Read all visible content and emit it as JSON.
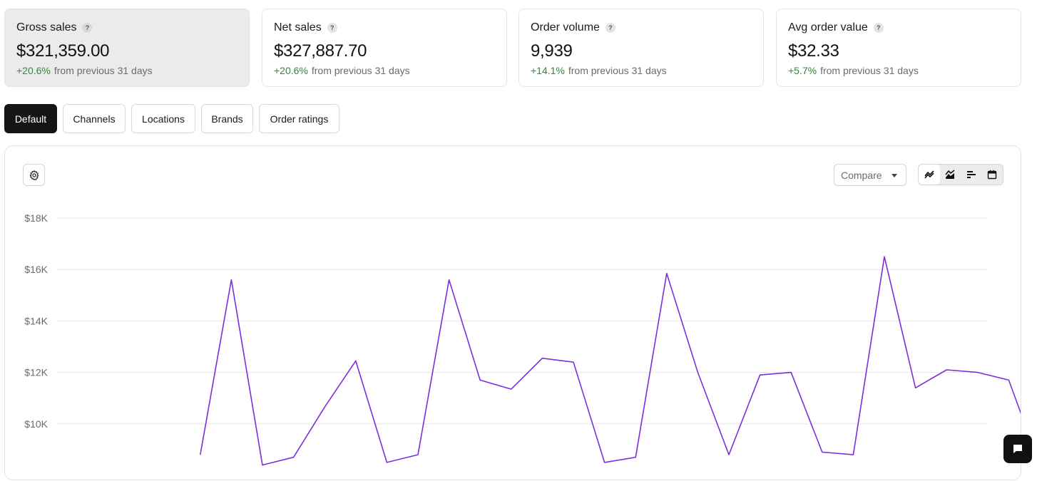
{
  "metrics": [
    {
      "title": "Gross sales",
      "value": "$321,359.00",
      "change": "+20.6%",
      "period": "from previous 31 days",
      "active": true
    },
    {
      "title": "Net sales",
      "value": "$327,887.70",
      "change": "+20.6%",
      "period": "from previous 31 days",
      "active": false
    },
    {
      "title": "Order volume",
      "value": "9,939",
      "change": "+14.1%",
      "period": "from previous 31 days",
      "active": false
    },
    {
      "title": "Avg order value",
      "value": "$32.33",
      "change": "+5.7%",
      "period": "from previous 31 days",
      "active": false
    }
  ],
  "help_glyph": "?",
  "tabs": [
    "Default",
    "Channels",
    "Locations",
    "Brands",
    "Order ratings"
  ],
  "active_tab": "Default",
  "toolbar": {
    "compare_label": "Compare",
    "view_icons": [
      "line-chart-icon",
      "area-chart-icon",
      "bar-chart-icon",
      "calendar-icon"
    ],
    "active_view": "line-chart-icon"
  },
  "colors": {
    "series": "#7b2fdc",
    "positive": "#2f8a3c",
    "active_tab": "#151515",
    "active_card": "#ebebeb"
  },
  "chart_data": {
    "type": "line",
    "title": "",
    "xlabel": "",
    "ylabel": "",
    "yticks": [
      "$10K",
      "$12K",
      "$14K",
      "$16K",
      "$18K"
    ],
    "ytick_values": [
      10000,
      12000,
      14000,
      16000,
      18000
    ],
    "grid": true,
    "x_range": [
      0,
      29
    ],
    "x_visible_from": 3,
    "series": [
      {
        "x": [
          3,
          4,
          5,
          6,
          7,
          8,
          9,
          10,
          11,
          12,
          13,
          14,
          15,
          16,
          17,
          18,
          19,
          20,
          21,
          22,
          23,
          24,
          25,
          26,
          27,
          28,
          29
        ],
        "values": [
          8800,
          15600,
          8400,
          8700,
          10650,
          12450,
          8500,
          8800,
          15600,
          11700,
          11350,
          12550,
          12400,
          8500,
          8700,
          15850,
          12000,
          8800,
          11900,
          12000,
          8900,
          8800,
          16500,
          11400,
          12100,
          12000,
          11700
        ]
      }
    ],
    "tail": {
      "x": 30,
      "value": 8400
    }
  }
}
